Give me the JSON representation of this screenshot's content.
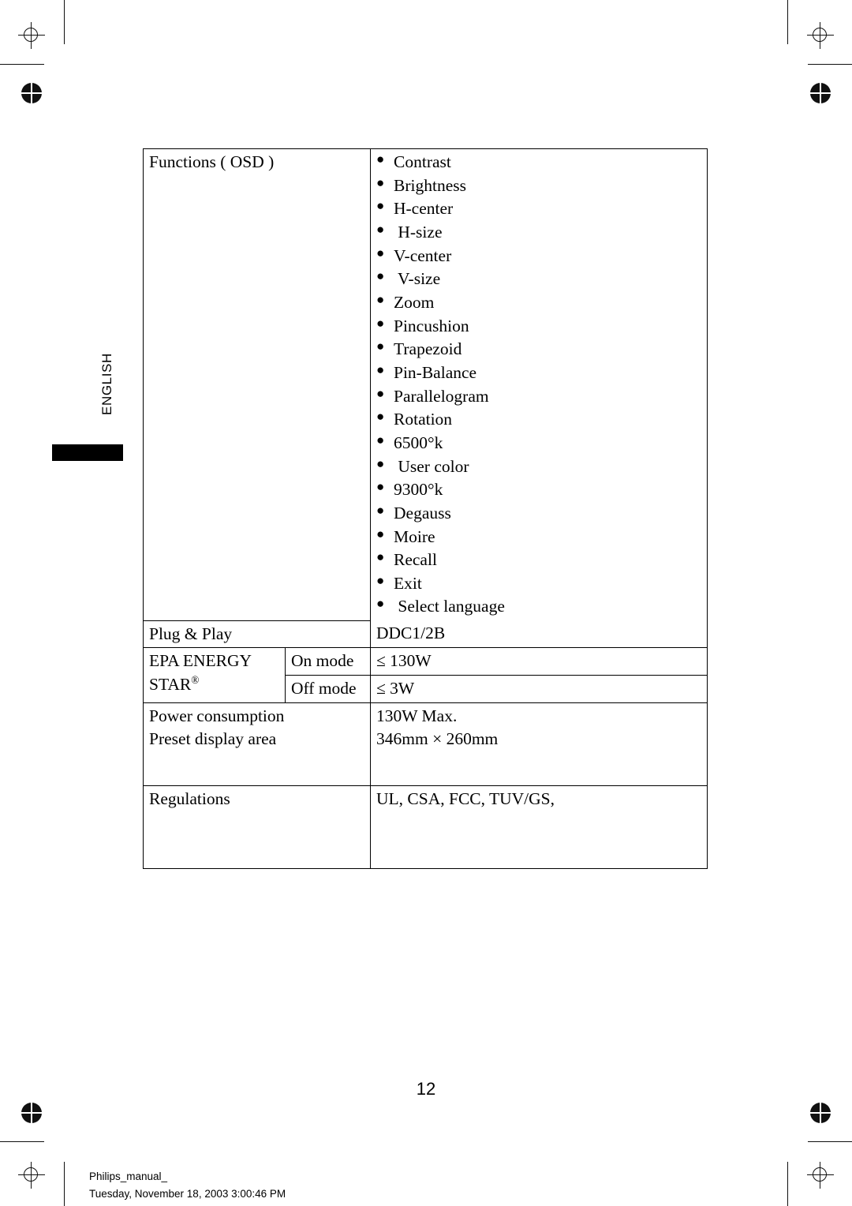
{
  "page": {
    "number": "12",
    "side_tab_label": "ENGLISH"
  },
  "footer": {
    "filename": "Philips_manual_",
    "timestamp": "Tuesday, November 18, 2003 3:00:46 PM"
  },
  "spec_table": {
    "functions": {
      "label": "Functions ( OSD )",
      "items": [
        "Contrast",
        "Brightness",
        "H-center",
        " H-size",
        "V-center",
        " V-size",
        "Zoom",
        "Pincushion",
        "Trapezoid",
        "Pin-Balance",
        "Parallelogram",
        "Rotation",
        "6500°k",
        " User color",
        "9300°k",
        "Degauss",
        "Moire",
        "Recall",
        "Exit",
        " Select language"
      ]
    },
    "plug_and_play": {
      "label": "Plug & Play",
      "value": "DDC1/2B"
    },
    "energy_star": {
      "label_line1": "EPA ENERGY",
      "label_line2": "STAR",
      "label_superscript": "®",
      "rows": [
        {
          "mode": "On mode",
          "value": "≤ 130W"
        },
        {
          "mode": "Off mode",
          "value": "≤ 3W"
        }
      ]
    },
    "power": {
      "label_line1": "Power consumption",
      "label_line2": "Preset display area",
      "value_line1": "130W Max.",
      "value_line2": "346mm × 260mm"
    },
    "regulations": {
      "label": "Regulations",
      "value": "UL, CSA, FCC, TUV/GS,"
    }
  }
}
